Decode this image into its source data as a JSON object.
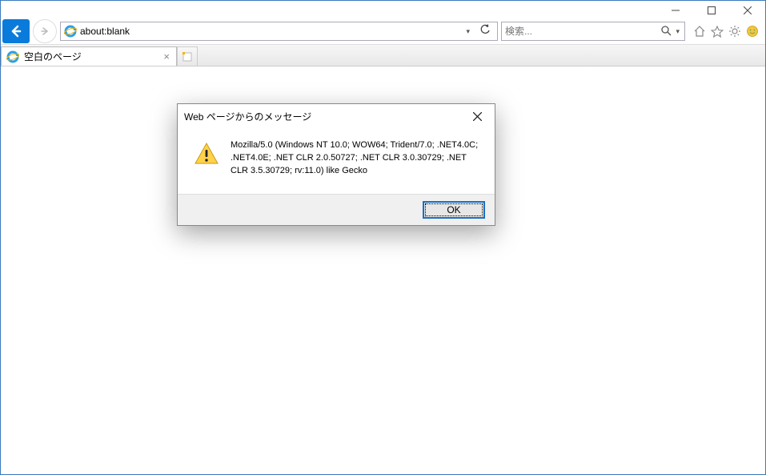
{
  "window": {
    "controls": {
      "min": "min",
      "max": "max",
      "close": "close"
    }
  },
  "nav": {
    "address_value": "about:blank",
    "search_placeholder": "検索..."
  },
  "tab": {
    "title": "空白のページ"
  },
  "dialog": {
    "title": "Web ページからのメッセージ",
    "message": "Mozilla/5.0 (Windows NT 10.0; WOW64; Trident/7.0; .NET4.0C; .NET4.0E; .NET CLR 2.0.50727; .NET CLR 3.0.30729; .NET CLR 3.5.30729; rv:11.0) like Gecko",
    "ok_label": "OK"
  }
}
